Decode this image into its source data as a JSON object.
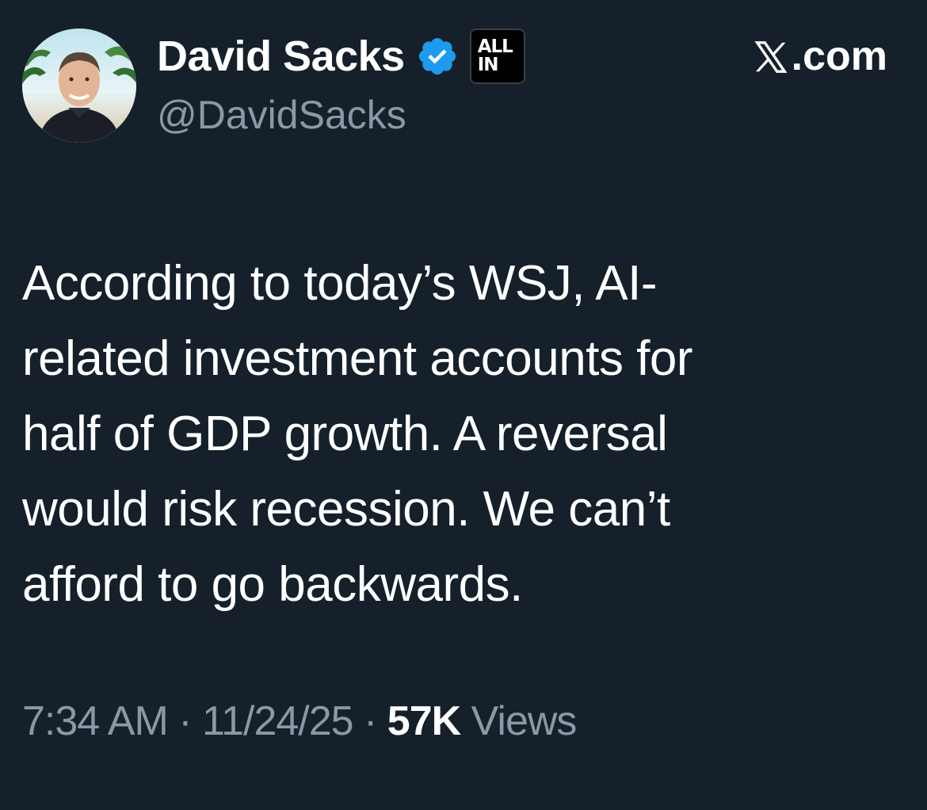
{
  "author": {
    "display_name": "David Sacks",
    "handle": "@DavidSacks",
    "avatar_icon": "profile-photo",
    "verified_icon": "verified-badge-icon",
    "verified_color": "#1d9bf0",
    "affiliate_badge": {
      "line1": "ALL",
      "line2": "IN"
    }
  },
  "source": {
    "logo_text": ".com",
    "logo_icon": "x-logo-icon"
  },
  "tweet": {
    "text_lines": [
      "According to today’s WSJ, AI-",
      "related investment accounts for",
      "half of GDP growth. A reversal",
      "would risk recession. We can’t",
      "afford to go backwards."
    ]
  },
  "meta": {
    "time": "7:34 AM",
    "separator": " · ",
    "date": "11/24/25",
    "views_count": "57K",
    "views_label": " Views"
  },
  "colors": {
    "background": "#15202b",
    "primary_text": "#ffffff",
    "secondary_text": "#8b98a5",
    "accent": "#1d9bf0"
  }
}
